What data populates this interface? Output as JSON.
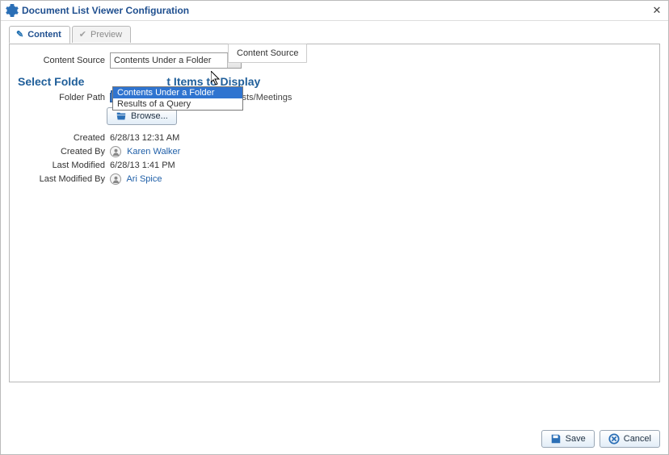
{
  "dialog": {
    "title": "Document List Viewer Configuration"
  },
  "tabs": {
    "content": "Content",
    "preview": "Preview"
  },
  "tooltip": "Content Source",
  "form": {
    "content_source_label": "Content Source",
    "content_source_value": "Contents Under a Folder",
    "dropdown_options": [
      "Contents Under a Folder",
      "Results of a Query"
    ],
    "heading_prefix": "Select Folde",
    "heading_suffix": "t Items to Display",
    "folder_path_label": "Folder Path",
    "folder_path_value": "/WebCenter0113PS7/Philatelists/Meetings",
    "browse_label": "Browse...",
    "created_label": "Created",
    "created_value": "6/28/13 12:31 AM",
    "created_by_label": "Created By",
    "created_by_value": "Karen Walker",
    "last_modified_label": "Last Modified",
    "last_modified_value": "6/28/13 1:41 PM",
    "last_modified_by_label": "Last Modified By",
    "last_modified_by_value": "Ari Spice"
  },
  "buttons": {
    "save": "Save",
    "cancel": "Cancel"
  }
}
